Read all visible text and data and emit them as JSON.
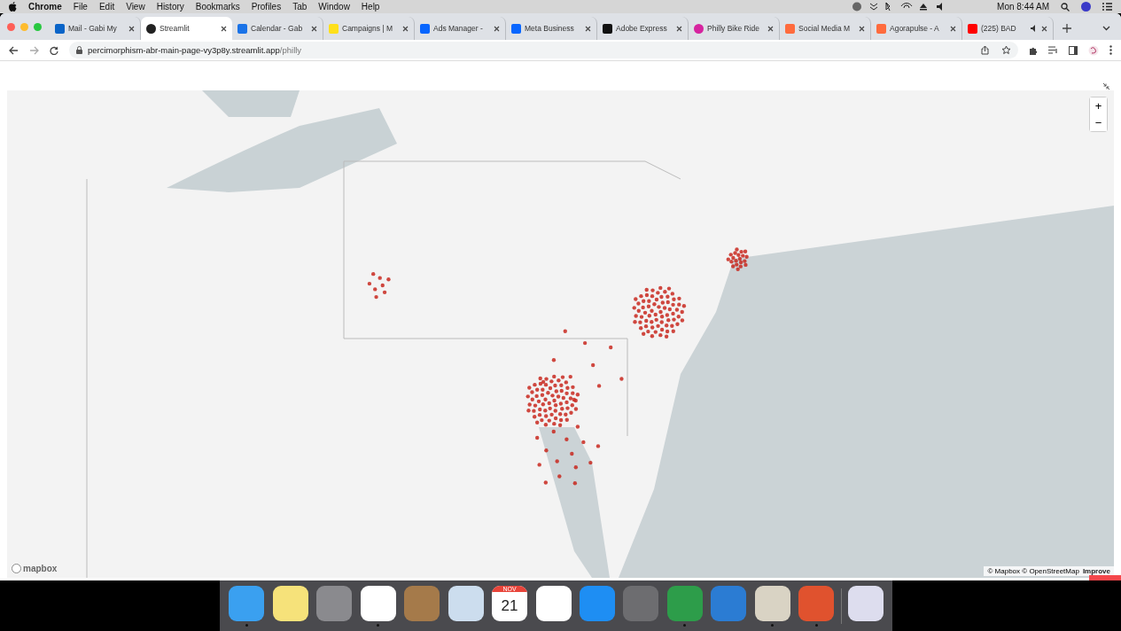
{
  "menu_bar": {
    "app": "Chrome",
    "menus": [
      "File",
      "Edit",
      "View",
      "History",
      "Bookmarks",
      "Profiles",
      "Tab",
      "Window",
      "Help"
    ],
    "clock": "Mon 8:44 AM"
  },
  "tabs": [
    {
      "title": "Mail - Gabi My",
      "kind": "outlook",
      "selected": false
    },
    {
      "title": "Streamlit",
      "kind": "streamlit",
      "selected": true
    },
    {
      "title": "Calendar - Gab",
      "kind": "calendar",
      "selected": false
    },
    {
      "title": "Campaigns | M",
      "kind": "mailchimp",
      "selected": false
    },
    {
      "title": "Ads Manager -",
      "kind": "meta",
      "selected": false
    },
    {
      "title": "Meta Business",
      "kind": "meta",
      "selected": false
    },
    {
      "title": "Adobe Express",
      "kind": "adobe",
      "selected": false
    },
    {
      "title": "Philly Bike Ride",
      "kind": "instagram",
      "selected": false
    },
    {
      "title": "Social Media M",
      "kind": "agora",
      "selected": false
    },
    {
      "title": "Agorapulse - A",
      "kind": "agora",
      "selected": false
    },
    {
      "title": "(225) BAD",
      "kind": "youtube",
      "selected": false,
      "audio": true
    }
  ],
  "address_bar": {
    "host": "percimorphism-abr-main-page-vy3p8y.streamlit.app",
    "path": "/philly"
  },
  "map": {
    "logo": "mapbox",
    "attribution": "© Mapbox © OpenStreetMap",
    "improve": "Improve",
    "zoom_in": "+",
    "zoom_out": "−"
  },
  "dock": [
    {
      "kind": "finder",
      "running": true
    },
    {
      "kind": "stickies",
      "running": false
    },
    {
      "kind": "launchpad",
      "running": false
    },
    {
      "kind": "chrome",
      "running": true
    },
    {
      "kind": "contacts",
      "running": false
    },
    {
      "kind": "preview",
      "running": false
    },
    {
      "kind": "calendar",
      "running": false,
      "month": "NOV",
      "day": "21"
    },
    {
      "kind": "photos",
      "running": false
    },
    {
      "kind": "appstore",
      "running": false
    },
    {
      "kind": "settings",
      "running": false
    },
    {
      "kind": "excel",
      "running": true
    },
    {
      "kind": "word",
      "running": false
    },
    {
      "kind": "calculator",
      "running": true
    },
    {
      "kind": "powerpoint",
      "running": true
    },
    {
      "kind": "trash",
      "running": false
    }
  ]
}
